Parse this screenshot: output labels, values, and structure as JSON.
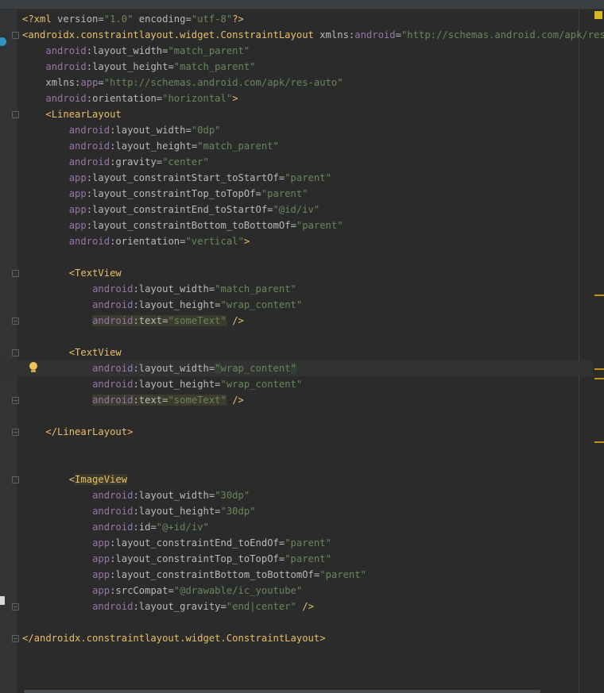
{
  "editor": {
    "language": "xml",
    "inspection_status": "warning",
    "lines": [
      [
        {
          "t": "<?xml ",
          "c": "decl"
        },
        {
          "t": "version",
          "c": "attr"
        },
        {
          "t": "=",
          "c": "plain"
        },
        {
          "t": "\"1.0\"",
          "c": "val"
        },
        {
          "t": " ",
          "c": "plain"
        },
        {
          "t": "encoding",
          "c": "attr"
        },
        {
          "t": "=",
          "c": "plain"
        },
        {
          "t": "\"utf-8\"",
          "c": "val"
        },
        {
          "t": "?>",
          "c": "decl"
        }
      ],
      [
        {
          "t": "<androidx.constraintlayout.widget.ConstraintLayout",
          "c": "tag"
        },
        {
          "t": " ",
          "c": "plain"
        },
        {
          "t": "xmlns:",
          "c": "attr"
        },
        {
          "t": "android",
          "c": "ns"
        },
        {
          "t": "=",
          "c": "plain"
        },
        {
          "t": "\"http://schemas.android.com/apk/res/andr",
          "c": "val"
        }
      ],
      [
        {
          "t": "    ",
          "c": "plain"
        },
        {
          "t": "android",
          "c": "ns"
        },
        {
          "t": ":layout_width=",
          "c": "attr"
        },
        {
          "t": "\"match_parent\"",
          "c": "val"
        }
      ],
      [
        {
          "t": "    ",
          "c": "plain"
        },
        {
          "t": "android",
          "c": "ns"
        },
        {
          "t": ":layout_height=",
          "c": "attr"
        },
        {
          "t": "\"match_parent\"",
          "c": "val"
        }
      ],
      [
        {
          "t": "    ",
          "c": "plain"
        },
        {
          "t": "xmlns:",
          "c": "attr"
        },
        {
          "t": "app",
          "c": "ns"
        },
        {
          "t": "=",
          "c": "plain"
        },
        {
          "t": "\"http://schemas.android.com/apk/res-auto\"",
          "c": "val"
        }
      ],
      [
        {
          "t": "    ",
          "c": "plain"
        },
        {
          "t": "android",
          "c": "ns"
        },
        {
          "t": ":orientation=",
          "c": "attr"
        },
        {
          "t": "\"horizontal\"",
          "c": "val"
        },
        {
          "t": ">",
          "c": "tag"
        }
      ],
      [
        {
          "t": "    ",
          "c": "plain"
        },
        {
          "t": "<LinearLayout",
          "c": "tag"
        }
      ],
      [
        {
          "t": "        ",
          "c": "plain"
        },
        {
          "t": "android",
          "c": "ns"
        },
        {
          "t": ":layout_width=",
          "c": "attr"
        },
        {
          "t": "\"0dp\"",
          "c": "val"
        }
      ],
      [
        {
          "t": "        ",
          "c": "plain"
        },
        {
          "t": "android",
          "c": "ns"
        },
        {
          "t": ":layout_height=",
          "c": "attr"
        },
        {
          "t": "\"match_parent\"",
          "c": "val"
        }
      ],
      [
        {
          "t": "        ",
          "c": "plain"
        },
        {
          "t": "android",
          "c": "ns"
        },
        {
          "t": ":gravity=",
          "c": "attr"
        },
        {
          "t": "\"center\"",
          "c": "val"
        }
      ],
      [
        {
          "t": "        ",
          "c": "plain"
        },
        {
          "t": "app",
          "c": "ns"
        },
        {
          "t": ":layout_constraintStart_toStartOf=",
          "c": "attr"
        },
        {
          "t": "\"parent\"",
          "c": "val"
        }
      ],
      [
        {
          "t": "        ",
          "c": "plain"
        },
        {
          "t": "app",
          "c": "ns"
        },
        {
          "t": ":layout_constraintTop_toTopOf=",
          "c": "attr"
        },
        {
          "t": "\"parent\"",
          "c": "val"
        }
      ],
      [
        {
          "t": "        ",
          "c": "plain"
        },
        {
          "t": "app",
          "c": "ns"
        },
        {
          "t": ":layout_constraintEnd_toStartOf=",
          "c": "attr"
        },
        {
          "t": "\"@id/iv\"",
          "c": "val"
        }
      ],
      [
        {
          "t": "        ",
          "c": "plain"
        },
        {
          "t": "app",
          "c": "ns"
        },
        {
          "t": ":layout_constraintBottom_toBottomOf=",
          "c": "attr"
        },
        {
          "t": "\"parent\"",
          "c": "val"
        }
      ],
      [
        {
          "t": "        ",
          "c": "plain"
        },
        {
          "t": "android",
          "c": "ns"
        },
        {
          "t": ":orientation=",
          "c": "attr"
        },
        {
          "t": "\"vertical\"",
          "c": "val"
        },
        {
          "t": ">",
          "c": "tag"
        }
      ],
      [],
      [
        {
          "t": "        ",
          "c": "plain"
        },
        {
          "t": "<TextView",
          "c": "tag"
        }
      ],
      [
        {
          "t": "            ",
          "c": "plain"
        },
        {
          "t": "android",
          "c": "ns"
        },
        {
          "t": ":layout_width=",
          "c": "attr"
        },
        {
          "t": "\"match_parent\"",
          "c": "val"
        }
      ],
      [
        {
          "t": "            ",
          "c": "plain"
        },
        {
          "t": "android",
          "c": "ns"
        },
        {
          "t": ":layout_height=",
          "c": "attr"
        },
        {
          "t": "\"wrap_content\"",
          "c": "val"
        }
      ],
      [
        {
          "t": "            ",
          "c": "plain"
        },
        {
          "t": "android",
          "c": "ns",
          "h": "warn"
        },
        {
          "t": ":text=",
          "c": "attr",
          "h": "warn"
        },
        {
          "t": "\"someText\"",
          "c": "val",
          "h": "warn"
        },
        {
          "t": " ",
          "c": "plain"
        },
        {
          "t": "/>",
          "c": "tag"
        }
      ],
      [],
      [
        {
          "t": "        ",
          "c": "plain"
        },
        {
          "t": "<TextView",
          "c": "tag"
        }
      ],
      [
        {
          "t": "            ",
          "c": "plain"
        },
        {
          "t": "android",
          "c": "ns"
        },
        {
          "t": ":layout_width=",
          "c": "attr"
        },
        {
          "t": "\"",
          "c": "val",
          "h": "caret"
        },
        {
          "t": "wrap_content",
          "c": "val"
        },
        {
          "t": "\"",
          "c": "val",
          "h": "caret"
        }
      ],
      [
        {
          "t": "            ",
          "c": "plain"
        },
        {
          "t": "android",
          "c": "ns"
        },
        {
          "t": ":layout_height=",
          "c": "attr"
        },
        {
          "t": "\"wrap_content\"",
          "c": "val"
        }
      ],
      [
        {
          "t": "            ",
          "c": "plain"
        },
        {
          "t": "android",
          "c": "ns",
          "h": "warn"
        },
        {
          "t": ":text=",
          "c": "attr",
          "h": "warn"
        },
        {
          "t": "\"someText\"",
          "c": "val",
          "h": "warn"
        },
        {
          "t": " ",
          "c": "plain"
        },
        {
          "t": "/>",
          "c": "tag"
        }
      ],
      [],
      [
        {
          "t": "    ",
          "c": "plain"
        },
        {
          "t": "</LinearLayout>",
          "c": "tag"
        }
      ],
      [],
      [],
      [
        {
          "t": "        ",
          "c": "plain"
        },
        {
          "t": "<",
          "c": "tag"
        },
        {
          "t": "ImageView",
          "c": "tag",
          "h": "tag"
        }
      ],
      [
        {
          "t": "            ",
          "c": "plain"
        },
        {
          "t": "android",
          "c": "ns"
        },
        {
          "t": ":layout_width=",
          "c": "attr"
        },
        {
          "t": "\"30dp\"",
          "c": "val"
        }
      ],
      [
        {
          "t": "            ",
          "c": "plain"
        },
        {
          "t": "android",
          "c": "ns"
        },
        {
          "t": ":layout_height=",
          "c": "attr"
        },
        {
          "t": "\"30dp\"",
          "c": "val"
        }
      ],
      [
        {
          "t": "            ",
          "c": "plain"
        },
        {
          "t": "android",
          "c": "ns"
        },
        {
          "t": ":id=",
          "c": "attr"
        },
        {
          "t": "\"@+id/iv\"",
          "c": "val"
        }
      ],
      [
        {
          "t": "            ",
          "c": "plain"
        },
        {
          "t": "app",
          "c": "ns"
        },
        {
          "t": ":layout_constraintEnd_toEndOf=",
          "c": "attr"
        },
        {
          "t": "\"parent\"",
          "c": "val"
        }
      ],
      [
        {
          "t": "            ",
          "c": "plain"
        },
        {
          "t": "app",
          "c": "ns"
        },
        {
          "t": ":layout_constraintTop_toTopOf=",
          "c": "attr"
        },
        {
          "t": "\"parent\"",
          "c": "val"
        }
      ],
      [
        {
          "t": "            ",
          "c": "plain"
        },
        {
          "t": "app",
          "c": "ns"
        },
        {
          "t": ":layout_constraintBottom_toBottomOf=",
          "c": "attr"
        },
        {
          "t": "\"parent\"",
          "c": "val"
        }
      ],
      [
        {
          "t": "            ",
          "c": "plain"
        },
        {
          "t": "app",
          "c": "ns"
        },
        {
          "t": ":srcCompat=",
          "c": "attr"
        },
        {
          "t": "\"@drawable/ic_youtube\"",
          "c": "val"
        }
      ],
      [
        {
          "t": "            ",
          "c": "plain"
        },
        {
          "t": "android",
          "c": "ns"
        },
        {
          "t": ":layout_gravity=",
          "c": "attr"
        },
        {
          "t": "\"end|center\"",
          "c": "val"
        },
        {
          "t": " ",
          "c": "plain"
        },
        {
          "t": "/>",
          "c": "tag"
        }
      ],
      [],
      [
        {
          "t": "</androidx.constraintlayout.widget.ConstraintLayout>",
          "c": "tag"
        }
      ]
    ]
  }
}
